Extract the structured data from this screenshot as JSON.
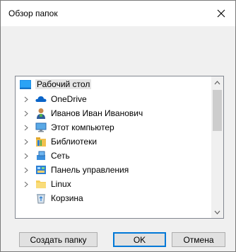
{
  "window": {
    "title": "Обзор папок",
    "close_icon": "close-icon"
  },
  "tree": {
    "root": {
      "label": "Рабочий стол",
      "icon": "desktop-icon",
      "selected": true
    },
    "items": [
      {
        "label": "OneDrive",
        "icon": "cloud-icon",
        "expandable": true
      },
      {
        "label": "Иванов Иван Иванович",
        "icon": "user-icon",
        "expandable": true
      },
      {
        "label": "Этот компьютер",
        "icon": "computer-icon",
        "expandable": true
      },
      {
        "label": "Библиотеки",
        "icon": "library-icon",
        "expandable": true
      },
      {
        "label": "Сеть",
        "icon": "network-icon",
        "expandable": true
      },
      {
        "label": "Панель управления",
        "icon": "control-panel-icon",
        "expandable": true
      },
      {
        "label": "Linux",
        "icon": "folder-icon",
        "expandable": true
      },
      {
        "label": "Корзина",
        "icon": "recycle-bin-icon",
        "expandable": false
      }
    ]
  },
  "buttons": {
    "new_folder": "Создать папку",
    "ok": "OK",
    "cancel": "Отмена"
  },
  "colors": {
    "selection": "#e5e5e5",
    "primary_border": "#0078d7",
    "button_face": "#e1e1e1"
  }
}
